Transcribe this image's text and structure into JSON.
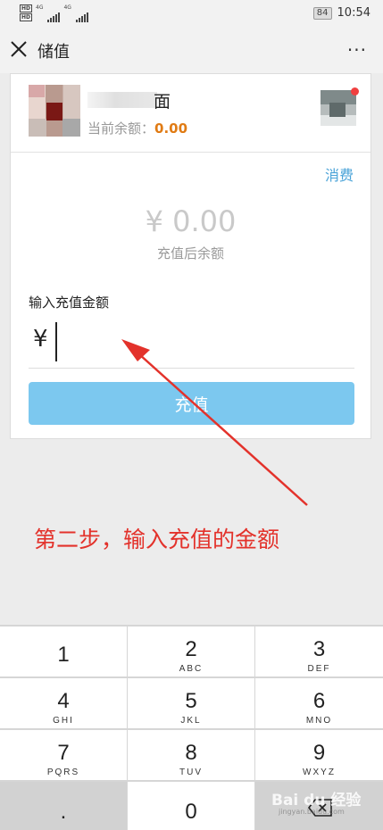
{
  "status_bar": {
    "hd_1": "HD",
    "hd_2": "HD",
    "net_1": "4G",
    "net_2": "4G",
    "battery": "84",
    "time": "10:54"
  },
  "nav": {
    "title": "储值",
    "more": "···"
  },
  "store": {
    "name": "面",
    "balance_label": "当前余额：",
    "balance_value": "0.00"
  },
  "consume_label": "消费",
  "after_balance": {
    "amount": "¥ 0.00",
    "label": "充值后余额"
  },
  "input": {
    "label": "输入充值金额",
    "currency": "¥",
    "value": ""
  },
  "recharge_label": "充值",
  "annotation": "第二步，输入充值的金额",
  "keypad": {
    "k1": {
      "digit": "1",
      "letters": ""
    },
    "k2": {
      "digit": "2",
      "letters": "ABC"
    },
    "k3": {
      "digit": "3",
      "letters": "DEF"
    },
    "k4": {
      "digit": "4",
      "letters": "GHI"
    },
    "k5": {
      "digit": "5",
      "letters": "JKL"
    },
    "k6": {
      "digit": "6",
      "letters": "MNO"
    },
    "k7": {
      "digit": "7",
      "letters": "PQRS"
    },
    "k8": {
      "digit": "8",
      "letters": "TUV"
    },
    "k9": {
      "digit": "9",
      "letters": "WXYZ"
    },
    "dot": ".",
    "k0": "0"
  },
  "watermark": {
    "logo": "Bai du 经验",
    "url": "jingyan.baidu.com"
  },
  "colors": {
    "accent_orange": "#e07b14",
    "link_blue": "#4aa3d8",
    "button_blue": "#7cc8ef",
    "annotation_red": "#e3322b"
  }
}
